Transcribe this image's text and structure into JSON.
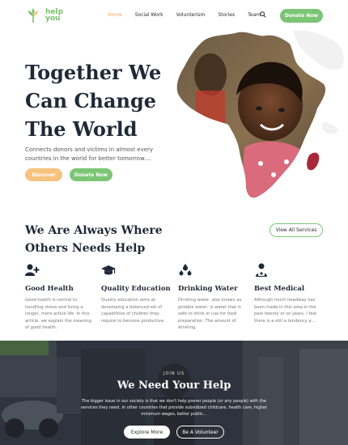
{
  "brand": {
    "line1": "help",
    "line2": "you"
  },
  "nav": {
    "items": [
      {
        "label": "Home",
        "active": true
      },
      {
        "label": "Social Work",
        "active": false
      },
      {
        "label": "Volunterism",
        "active": false
      },
      {
        "label": "Stories",
        "active": false
      },
      {
        "label": "Team",
        "active": false
      }
    ],
    "donate_label": "Donate Now"
  },
  "hero": {
    "title_lines": [
      "Together We",
      "Can Change",
      "The World"
    ],
    "subtitle": "Connects donors and victims in almost every countries in the world for better tomorrow....",
    "discover_label": "Discover",
    "donate_label": "Donate Now"
  },
  "services": {
    "title_line1": "We Are Always Where",
    "title_line2_prefix": "Others",
    "title_line2_highlight": "Needs Help",
    "view_all_label": "View All Services",
    "features": [
      {
        "icon": "user-plus-icon",
        "title": "Good Health",
        "text": "Good health is central to handling stress and living a longer, more active life. In this article, we explain the meaning of good health."
      },
      {
        "icon": "graduation-cap-icon",
        "title": "Quality Education",
        "text": "Quality education aims at developing a balanced set of capabilities of children they require to become productive."
      },
      {
        "icon": "water-drops-icon",
        "title": "Drinking Water",
        "text": "Drinking water, also known as potable water, is water that is safe to drink or use for food preparation. The amount of drinking."
      },
      {
        "icon": "medical-kit-icon",
        "title": "Best Medical",
        "text": "Although much headway has been made in this area in the past twenty or so years, I feel there is a still a tendency a..."
      }
    ]
  },
  "cta": {
    "eyebrow": "JOIN US",
    "title": "We Need Your Help",
    "text": "The bigger issue in our society is that we don't help poorer people (or any people) with the services they need. In other countries that provide subsidized childcare, health care, higher minimum wages, better public...",
    "explore_label": "Explore More",
    "volunteer_label": "Be A Volunteer"
  },
  "colors": {
    "green": "#7cc576",
    "orange": "#f6c27e",
    "dark": "#1f2937"
  }
}
